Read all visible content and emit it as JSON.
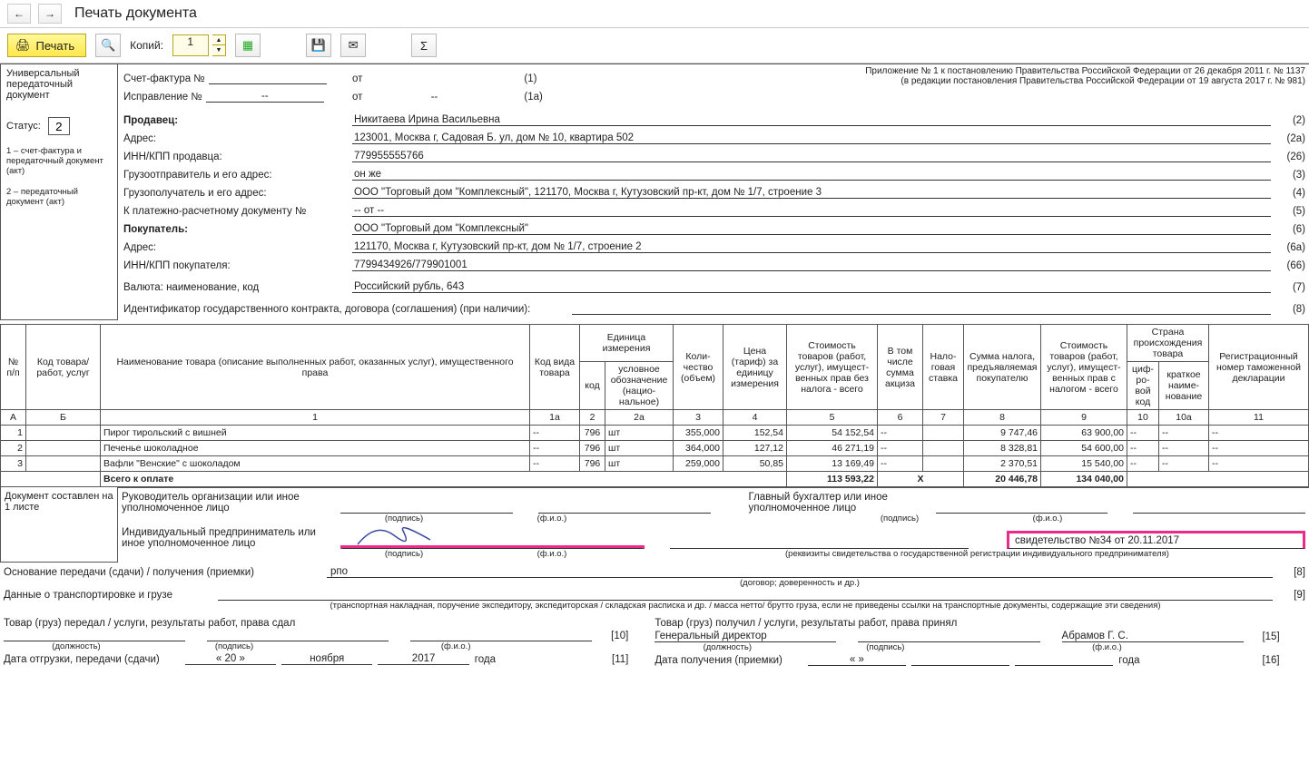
{
  "window": {
    "title": "Печать документа",
    "copies_label": "Копий:",
    "copies_value": "1",
    "print_label": "Печать"
  },
  "sidebox": {
    "l1": "Универсальный",
    "l2": "передаточный",
    "l3": "документ",
    "status_label": "Статус:",
    "status_value": "2",
    "note1": "1 – счет-фактура и передаточный документ (акт)",
    "note2": "2 – передаточный документ (акт)"
  },
  "form": {
    "apx_line1": "Приложение № 1 к постановлению Правительства Российской Федерации от 26 декабря 2011 г. № 1137",
    "apx_line2": "(в редакции постановления Правительства Российской Федерации от 19 августа 2017 г. № 981)",
    "invoice_label": "Счет-фактура №",
    "invoice_ot": "от",
    "invoice_num_ref": "(1)",
    "correction_label": "Исправление №",
    "correction_no": "--",
    "correction_ot": "от",
    "correction_date": "--",
    "correction_ref": "(1а)",
    "seller_l": "Продавец:",
    "seller_v": "Никитаева Ирина Васильевна",
    "addr_l": "Адрес:",
    "addr_v": "123001, Москва г, Садовая Б. ул, дом № 10, квартира 502",
    "inn_l": "ИНН/КПП продавца:",
    "inn_v": "779955555766",
    "shipper_l": "Грузоотправитель и его адрес:",
    "shipper_v": "он же",
    "consignee_l": "Грузополучатель и его адрес:",
    "consignee_v": "ООО \"Торговый дом \"Комплексный\", 121170, Москва г, Кутузовский пр-кт, дом № 1/7, строение 3",
    "paydoc_l": "К платежно-расчетному документу №",
    "paydoc_v": "-- от --",
    "buyer_l": "Покупатель:",
    "buyer_v": "ООО \"Торговый дом \"Комплексный\"",
    "baddr_l": "Адрес:",
    "baddr_v": "121170, Москва г, Кутузовский пр-кт, дом № 1/7, строение 2",
    "binn_l": "ИНН/КПП покупателя:",
    "binn_v": "7799434926/779901001",
    "curr_l": "Валюта: наименование, код",
    "curr_v": "Российский рубль, 643",
    "ident_l": "Идентификатор государственного контракта, договора (соглашения) (при наличии):",
    "ref2": "(2)",
    "ref2a": "(2а)",
    "ref26": "(26)",
    "ref3": "(3)",
    "ref4": "(4)",
    "ref5": "(5)",
    "ref6": "(6)",
    "ref6a": "(6а)",
    "ref66": "(66)",
    "ref7": "(7)",
    "ref8": "(8)"
  },
  "table": {
    "h": {
      "npp": "№ п/п",
      "code": "Код товара/ работ, услуг",
      "name": "Наименование товара (описание выполненных работ, оказанных услуг), имущественного права",
      "kind": "Код вида товара",
      "unit": "Единица измерения",
      "unit_code": "код",
      "unit_name": "условное обозна­чение (нацио­нальное)",
      "qty": "Коли­чество (объем)",
      "price": "Цена (тариф) за единицу измерения",
      "cost_notax": "Стоимость товаров (работ, услуг), имущест­венных прав без налога - всего",
      "excise": "В том числе сумма акциза",
      "taxrate": "Нало­говая ставка",
      "tax": "Сумма налога, предъявля­емая покупателю",
      "cost_tax": "Стоимость товаров (работ, услуг), имущест­венных прав с налогом - всего",
      "country": "Страна происхождения товара",
      "country_code": "циф­ро­вой код",
      "country_name": "краткое наиме­нование",
      "decl": "Регистрационный номер таможенной декларации"
    },
    "hrow": {
      "a": "А",
      "b": "Б",
      "c1": "1",
      "c1a": "1а",
      "c2": "2",
      "c2a": "2а",
      "c3": "3",
      "c4": "4",
      "c5": "5",
      "c6": "6",
      "c7": "7",
      "c8": "8",
      "c9": "9",
      "c10": "10",
      "c10a": "10а",
      "c11": "11"
    },
    "rows": [
      {
        "n": "1",
        "name": "Пирог тирольский с вишней",
        "kind": "--",
        "code": "796",
        "u": "шт",
        "qty": "355,000",
        "price": "152,54",
        "notax": "54 152,54",
        "excise": "--",
        "rate": "",
        "tax": "9 747,46",
        "wtax": "63 900,00",
        "cc": "--",
        "cn": "--",
        "decl": "--"
      },
      {
        "n": "2",
        "name": "Печенье шоколадное",
        "kind": "--",
        "code": "796",
        "u": "шт",
        "qty": "364,000",
        "price": "127,12",
        "notax": "46 271,19",
        "excise": "--",
        "rate": "",
        "tax": "8 328,81",
        "wtax": "54 600,00",
        "cc": "--",
        "cn": "--",
        "decl": "--"
      },
      {
        "n": "3",
        "name": "Вафли \"Венские\" с шоколадом",
        "kind": "--",
        "code": "796",
        "u": "шт",
        "qty": "259,000",
        "price": "50,85",
        "notax": "13 169,49",
        "excise": "--",
        "rate": "",
        "tax": "2 370,51",
        "wtax": "15 540,00",
        "cc": "--",
        "cn": "--",
        "decl": "--"
      }
    ],
    "total_label": "Всего к оплате",
    "total_notax": "113 593,22",
    "total_x": "X",
    "total_tax": "20 446,78",
    "total_wtax": "134 040,00"
  },
  "sig": {
    "docmade_l1": "Документ составлен на",
    "docmade_l2": "1 листе",
    "mgr": "Руководитель организации или иное уполномоченное лицо",
    "ip": "Индивидуальный предприниматель или иное уполномоченное лицо",
    "acc": "Главный бухгалтер или иное уполномоченное лицо",
    "podpis": "(подпись)",
    "fio": "(ф.и.о.)",
    "rekv": "(реквизиты свидетельства о государственной регистрации индивидуального предпринимателя)",
    "cert": "свидетельство №34 от 20.11.2017",
    "osn_l": "Основание передачи (сдачи) / получения (приемки)",
    "osn_v": "рпо",
    "osn_sub": "(договор; доверенность и др.)",
    "osn_ref": "[8]",
    "trans_l": "Данные о транспортировке и грузе",
    "trans_sub": "(транспортная накладная, поручение экспедитору, экспедиторская / складская расписка и др. / масса нетто/ брутто груза, если не приведены ссылки на транспортные документы, содержащие эти сведения)",
    "trans_ref": "[9]",
    "left_title": "Товар (груз) передал / услуги, результаты работ, права сдал",
    "right_title": "Товар (груз) получил / услуги, результаты работ, права принял",
    "gen_dir": "Генеральный директор",
    "abramov": "Абрамов Г. С.",
    "dolzh": "(должность)",
    "left_ref": "[10]",
    "right_ref": "[15]",
    "ship_date_l": "Дата отгрузки, передачи (сдачи)",
    "recv_date_l": "Дата получения (приемки)",
    "date_day": "« 20 »",
    "date_mon": "ноября",
    "date_year": "2017",
    "date_goda": "года",
    "recv_day": "«      »",
    "ship_ref": "[11]",
    "recv_ref": "[16]"
  }
}
